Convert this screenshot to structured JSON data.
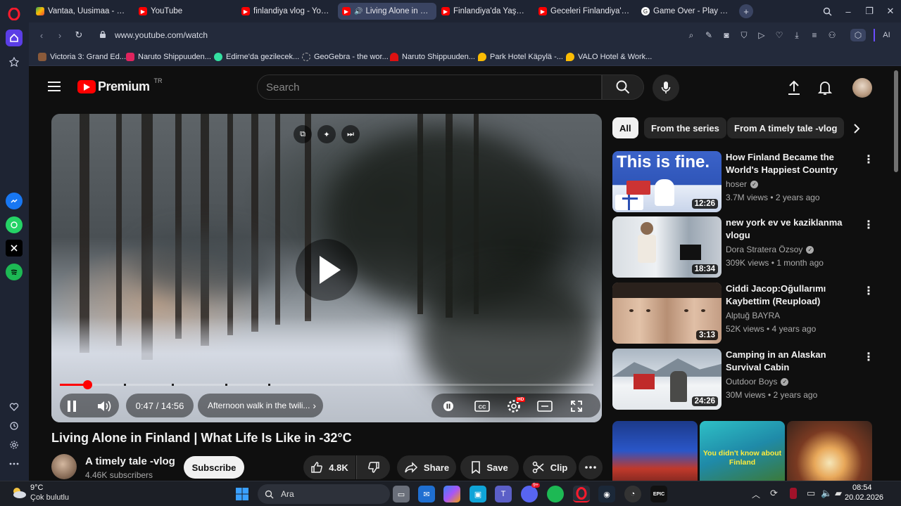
{
  "browser": {
    "tabs": [
      {
        "label": "Vantaa, Uusimaa - Google",
        "favicon": "maps-pin-icon"
      },
      {
        "label": "YouTube",
        "favicon": "youtube-icon"
      },
      {
        "label": "finlandiya vlog - YouTube",
        "favicon": "youtube-icon"
      },
      {
        "label": "Living Alone in Finland",
        "favicon": "youtube-icon",
        "active": true
      },
      {
        "label": "Finlandiya'da Yaşam | -26",
        "favicon": "youtube-icon"
      },
      {
        "label": "Geceleri Finlandiya'da yol",
        "favicon": "youtube-icon"
      },
      {
        "label": "Game Over - Play A_cunni",
        "favicon": "game-icon"
      }
    ],
    "url": "www.youtube.com/watch",
    "ai_label": "AI",
    "bookmarks": [
      {
        "label": "Victoria 3: Grand Ed..."
      },
      {
        "label": "Naruto Shippuuden..."
      },
      {
        "label": "Edirne'da gezilecek..."
      },
      {
        "label": "GeoGebra - the wor..."
      },
      {
        "label": "Naruto Shippuuden..."
      },
      {
        "label": "Park Hotel Käpylä -..."
      },
      {
        "label": "VALO Hotel & Work..."
      }
    ]
  },
  "youtube": {
    "logo_text": "Premium",
    "logo_region": "TR",
    "search_placeholder": "Search",
    "player": {
      "time": "0:47 / 14:56",
      "chapter": "Afternoon walk in the twili...",
      "progress_fraction": 0.052,
      "settings_badge": "HD",
      "chapter_marks": [
        0.12,
        0.21,
        0.31,
        0.39
      ]
    },
    "video": {
      "title": "Living Alone in Finland | What Life Is Like in -32°C",
      "channel": "A timely tale -vlog",
      "subscribers": "4.46K subscribers",
      "subscribe_label": "Subscribe",
      "likes": "4.8K",
      "share_label": "Share",
      "save_label": "Save",
      "clip_label": "Clip"
    },
    "chips": [
      "All",
      "From the series",
      "From A timely tale -vlog"
    ],
    "recommendations": [
      {
        "title": "How Finland Became the World's Happiest Country",
        "channel": "hoser",
        "verified": true,
        "meta": "3.7M views • 2 years ago",
        "duration": "12:26",
        "thumb_text": "This is fine."
      },
      {
        "title": "new york ev ve kaziklanma vlogu",
        "channel": "Dora Stratera Özsoy",
        "verified": true,
        "meta": "309K views • 1 month ago",
        "duration": "18:34"
      },
      {
        "title": "Ciddi Jacop:Oğullarımı Kaybettim (Reupload)",
        "channel": "Alptuğ BAYRA",
        "verified": false,
        "meta": "52K views • 4 years ago",
        "duration": "3:13"
      },
      {
        "title": "Camping in an Alaskan Survival Cabin",
        "channel": "Outdoor Boys",
        "verified": true,
        "meta": "30M views • 2 years ago",
        "duration": "24:26"
      }
    ],
    "shorts_text": "You didn't know about Finland"
  },
  "taskbar": {
    "weather_temp": "9°C",
    "weather_desc": "Çok bulutlu",
    "search_label": "Ara",
    "time": "08:54",
    "date": "20.02.2026",
    "discord_badge": "9+"
  },
  "colors": {
    "accent_red": "#ff0000",
    "page_bg": "#0f0f0f",
    "chrome_bg": "#1e2433"
  }
}
